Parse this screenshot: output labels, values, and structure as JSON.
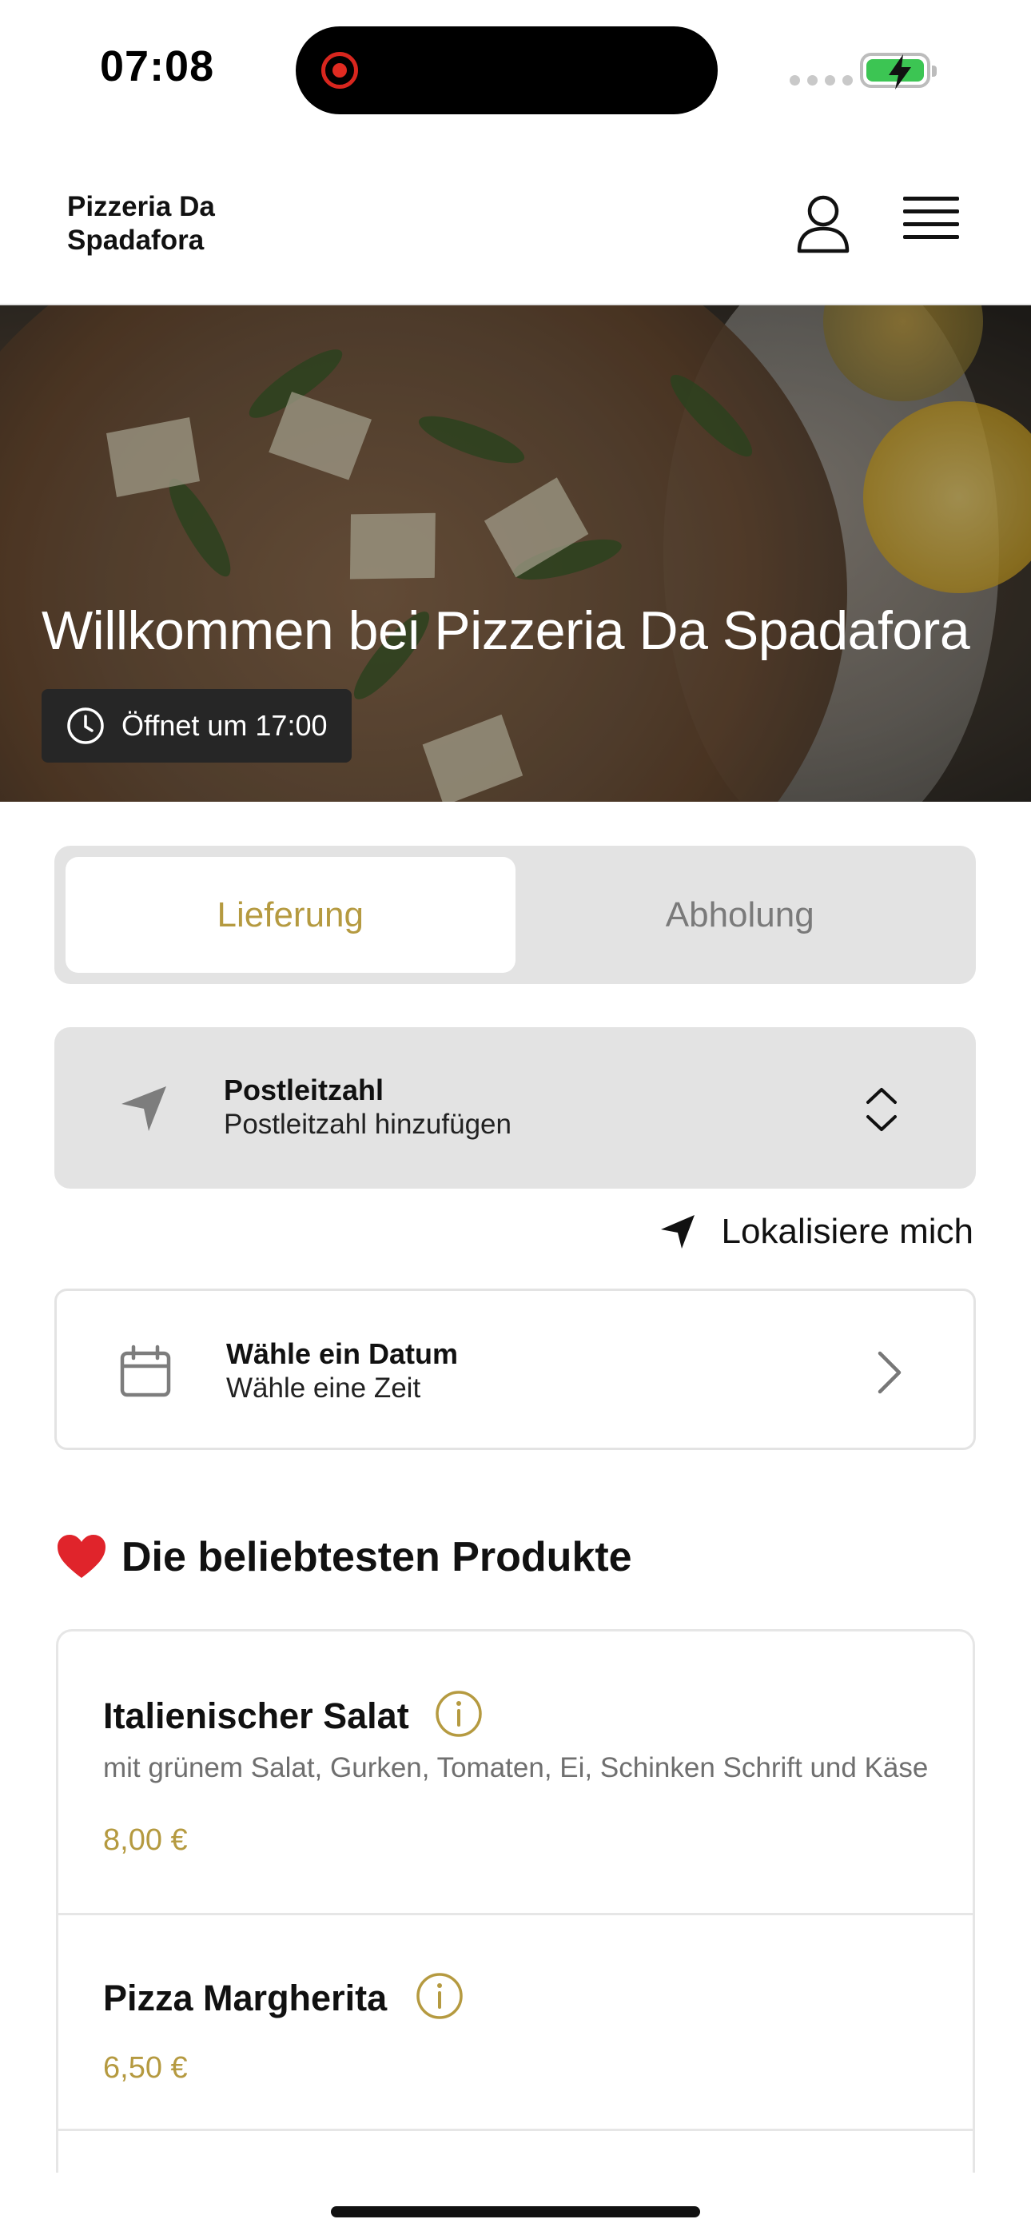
{
  "status_bar": {
    "time": "07:08"
  },
  "header": {
    "brand": "Pizzeria Da Spadafora"
  },
  "hero": {
    "title": "Willkommen bei Pizzeria Da Spadafora",
    "opening": "Öffnet um 17:00"
  },
  "order_mode": {
    "tabs": [
      {
        "label": "Lieferung",
        "active": true
      },
      {
        "label": "Abholung",
        "active": false
      }
    ]
  },
  "postcode": {
    "title": "Postleitzahl",
    "placeholder": "Postleitzahl hinzufügen"
  },
  "locate": {
    "label": "Lokalisiere mich"
  },
  "schedule": {
    "title": "Wähle ein Datum",
    "subtitle": "Wähle eine Zeit"
  },
  "popular": {
    "emoji": "❤️",
    "title": "Die beliebtesten Produkte",
    "products": [
      {
        "name": "Italienischer Salat",
        "description": "mit grünem Salat, Gurken, Tomaten, Ei, Schinken Schrift und Käse",
        "price": "8,00 €"
      },
      {
        "name": "Pizza Margherita",
        "description": "",
        "price": "6,50 €"
      }
    ]
  },
  "colors": {
    "accent": "#b59a40",
    "field_bg": "#e3e3e3",
    "battery": "#3cc553",
    "record": "#e02b21"
  }
}
